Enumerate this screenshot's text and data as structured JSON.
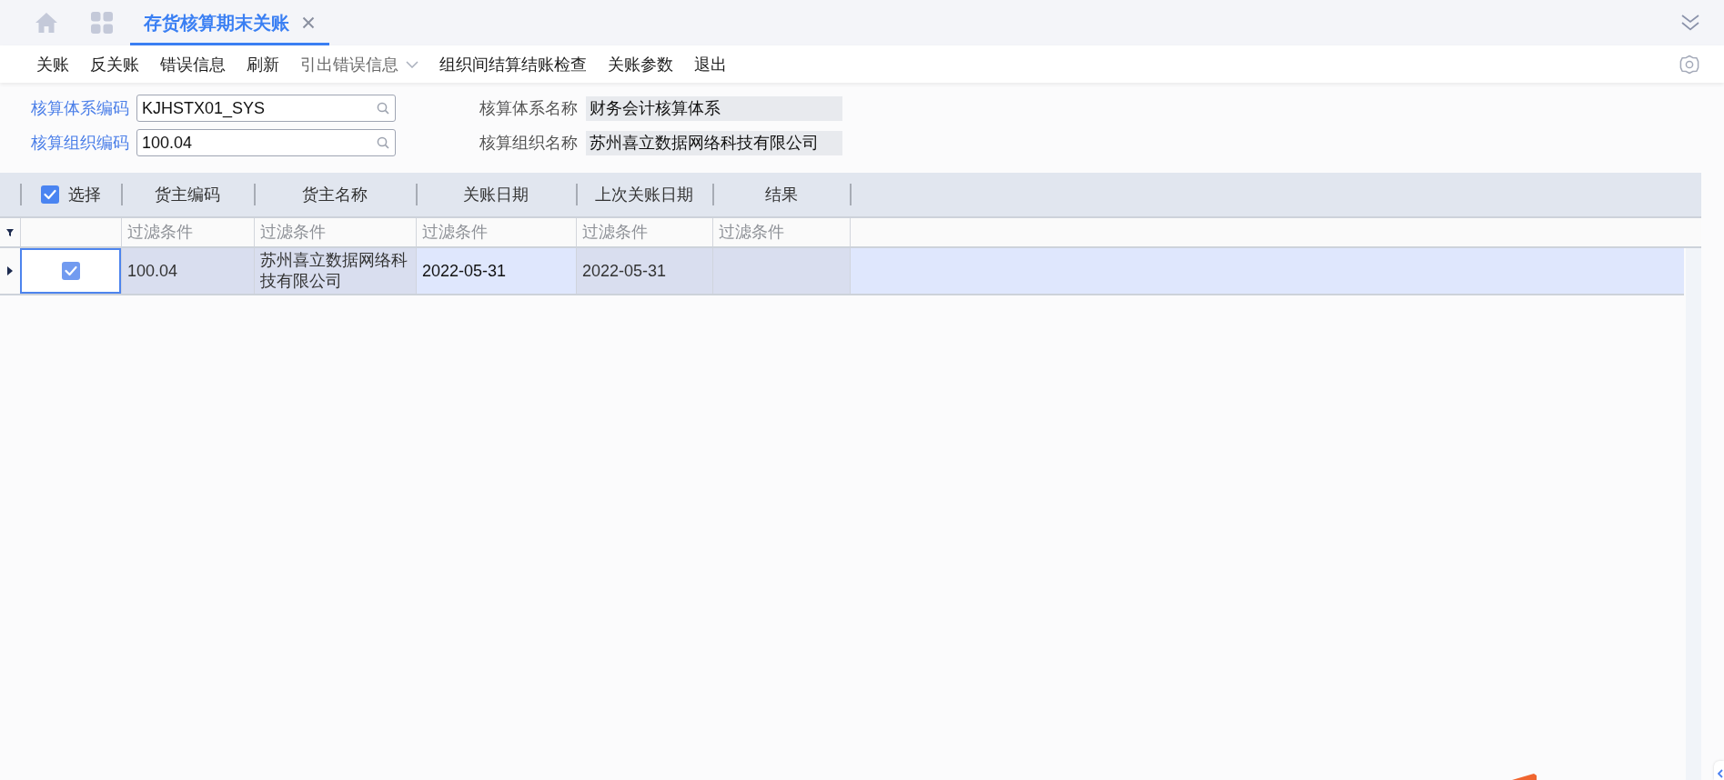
{
  "tab_bar": {
    "tabs": [
      {
        "label": "存货核算期末关账",
        "selected": true
      }
    ]
  },
  "toolbar": {
    "items": [
      {
        "label": "关账",
        "kind": "button",
        "disabled": false
      },
      {
        "label": "反关账",
        "kind": "button",
        "disabled": false
      },
      {
        "label": "错误信息",
        "kind": "button",
        "disabled": false
      },
      {
        "label": "刷新",
        "kind": "button",
        "disabled": false
      },
      {
        "label": "引出错误信息",
        "kind": "dropdown",
        "disabled": true
      },
      {
        "label": "组织间结算结账检查",
        "kind": "button",
        "disabled": false
      },
      {
        "label": "关账参数",
        "kind": "button",
        "disabled": false
      },
      {
        "label": "退出",
        "kind": "button",
        "disabled": false
      }
    ]
  },
  "form": {
    "rows": [
      {
        "fields": [
          {
            "kind": "lookup",
            "label": "核算体系编码",
            "value": "KJHSTX01_SYS"
          },
          {
            "kind": "readonly",
            "label": "核算体系名称",
            "value": "财务会计核算体系"
          }
        ]
      },
      {
        "fields": [
          {
            "kind": "lookup",
            "label": "核算组织编码",
            "value": "100.04"
          },
          {
            "kind": "readonly",
            "label": "核算组织名称",
            "value": "苏州喜立数据网络科技有限公司"
          }
        ]
      }
    ]
  },
  "table": {
    "columns": [
      {
        "kind": "checkbox",
        "label": "选择",
        "checked": true
      },
      {
        "kind": "text",
        "label": "货主编码",
        "placeholder": "过滤条件"
      },
      {
        "kind": "text",
        "label": "货主名称",
        "placeholder": "过滤条件"
      },
      {
        "kind": "text",
        "label": "关账日期",
        "placeholder": "过滤条件"
      },
      {
        "kind": "text",
        "label": "上次关账日期",
        "placeholder": "过滤条件"
      },
      {
        "kind": "text",
        "label": "结果",
        "placeholder": "过滤条件"
      }
    ],
    "rows": [
      {
        "selected": true,
        "cells": [
          {
            "kind": "checkbox",
            "checked": true,
            "focused": true
          },
          {
            "kind": "text",
            "text": "100.04",
            "locked": true,
            "focused": false
          },
          {
            "kind": "text",
            "text": "苏州喜立数据网络科技有限公司",
            "locked": true,
            "focused": false
          },
          {
            "kind": "text",
            "text": "2022-05-31",
            "locked": false,
            "focused": false
          },
          {
            "kind": "text",
            "text": "2022-05-31",
            "locked": true,
            "focused": false
          },
          {
            "kind": "text",
            "locked": true,
            "focused": false
          }
        ]
      }
    ]
  }
}
